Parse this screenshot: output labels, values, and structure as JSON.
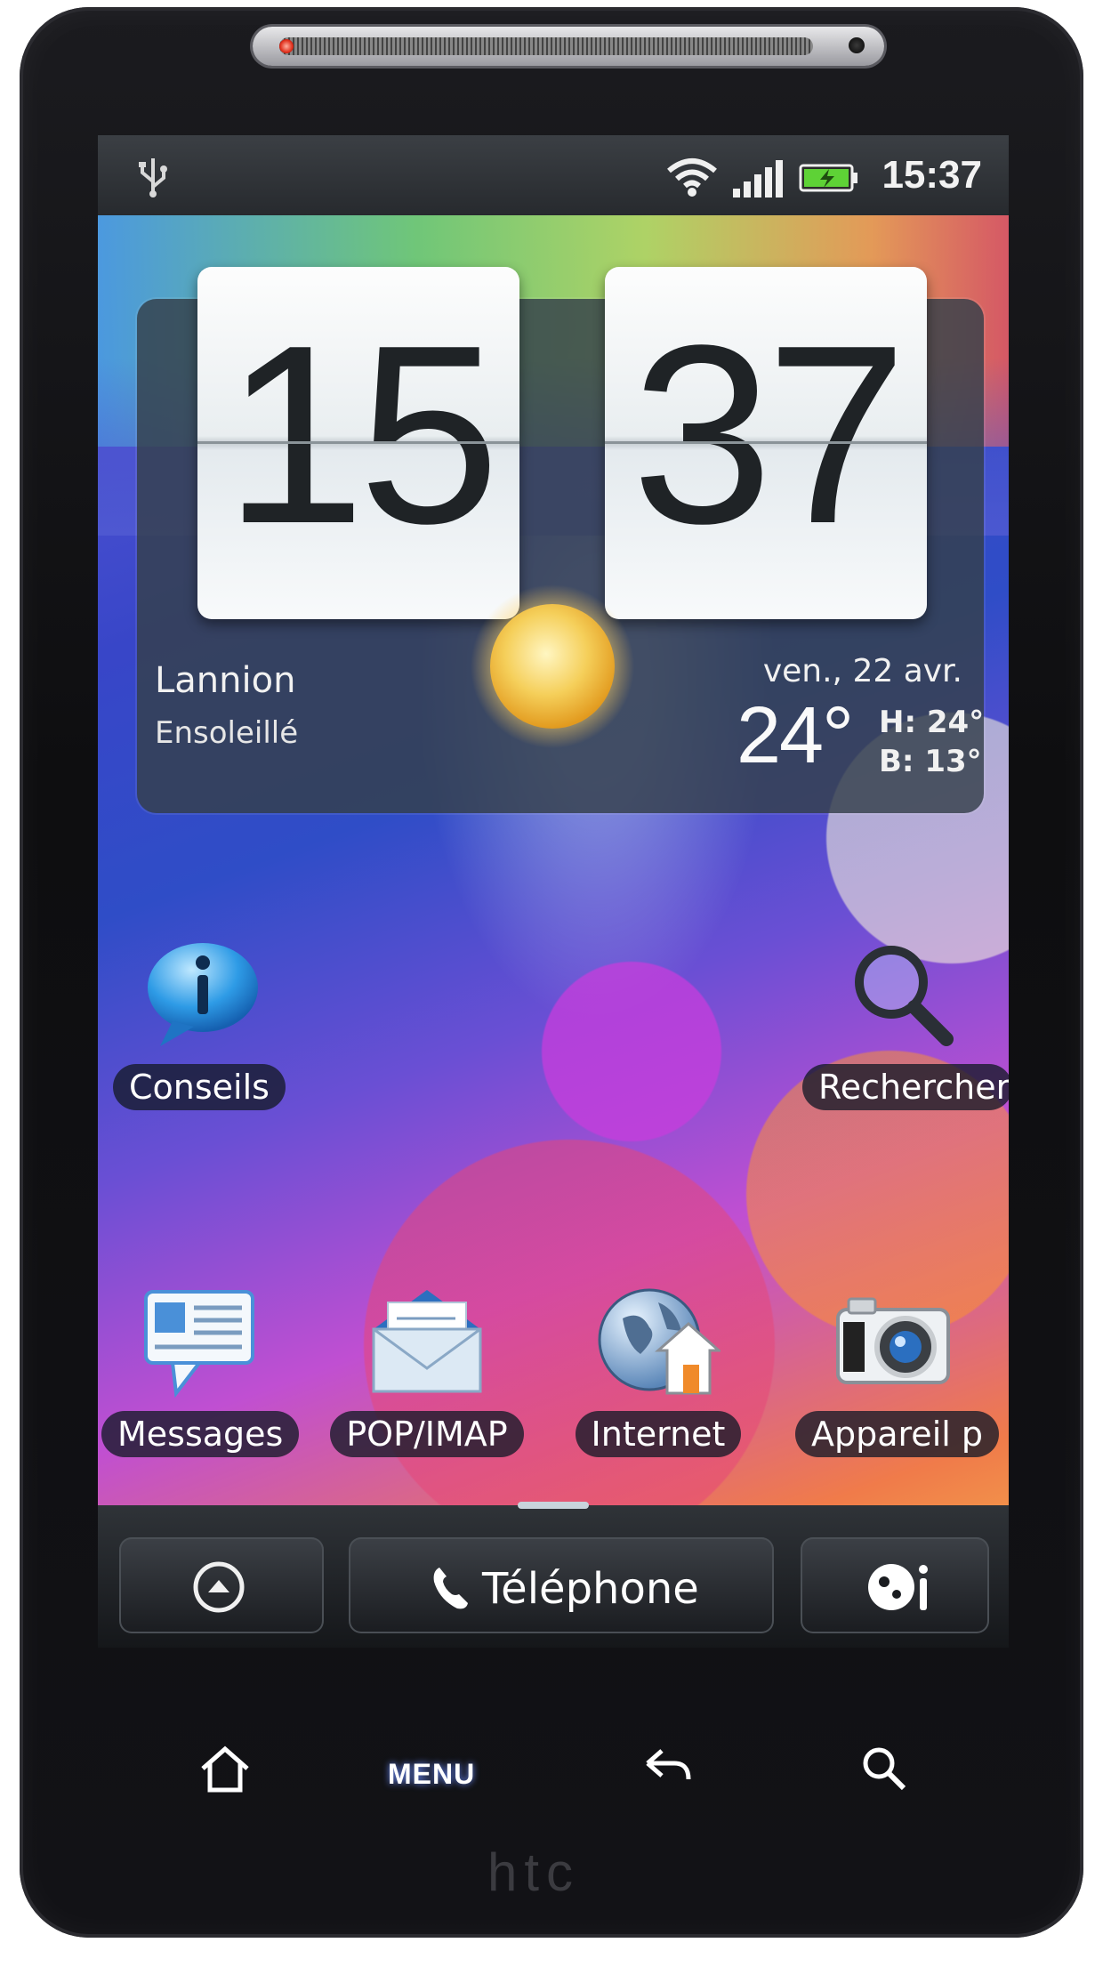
{
  "status_bar": {
    "time": "15:37",
    "icons": [
      "usb-icon",
      "wifi-icon",
      "signal-icon",
      "battery-icon"
    ]
  },
  "clock_widget": {
    "hours": "15",
    "minutes": "37"
  },
  "weather": {
    "city": "Lannion",
    "condition": "Ensoleillé",
    "date": "ven., 22 avr.",
    "temperature": "24°",
    "high": "H: 24°",
    "low": "B: 13°",
    "icon": "sun-icon"
  },
  "shortcuts": {
    "conseils": "Conseils",
    "rechercher": "Rechercher",
    "messages": "Messages",
    "popimap": "POP/IMAP",
    "internet": "Internet",
    "appareil": "Appareil p"
  },
  "dock": {
    "telephone_label": "Téléphone"
  },
  "hardware_keys": {
    "menu": "MENU"
  },
  "brand": "htc",
  "colors": {
    "widget_panel": "#34404a",
    "label_pill": "#141a28",
    "key_glow": "#6a8cff"
  }
}
